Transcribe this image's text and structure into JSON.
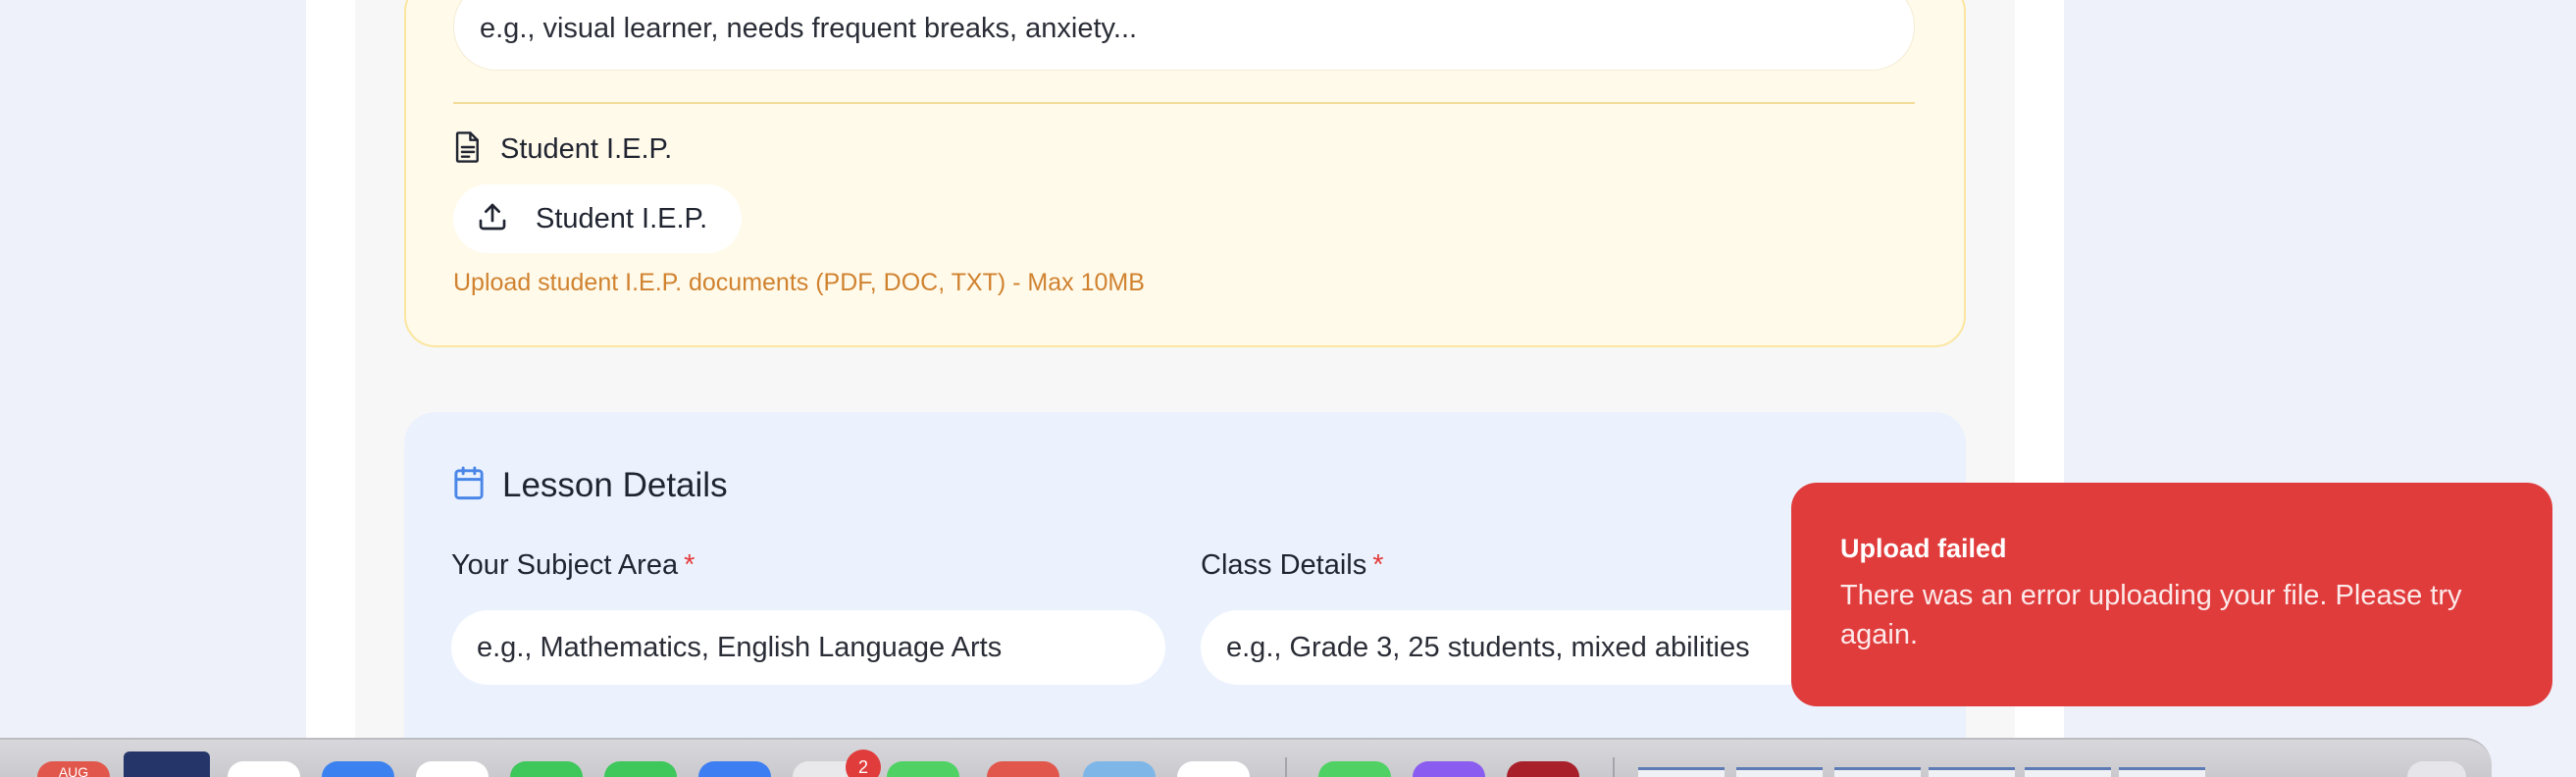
{
  "accommodations": {
    "input_value": "e.g., visual learner, needs frequent breaks, anxiety..."
  },
  "iep": {
    "heading": "Student I.E.P.",
    "upload_button_label": "Student I.E.P.",
    "upload_hint": "Upload student I.E.P. documents (PDF, DOC, TXT) - Max 10MB"
  },
  "lesson_details": {
    "title": "Lesson Details",
    "subject_label": "Your Subject Area",
    "subject_placeholder": "e.g., Mathematics, English Language Arts",
    "class_label": "Class Details",
    "class_placeholder": "e.g., Grade 3, 25 students, mixed abilities",
    "required_marker": "*"
  },
  "toast": {
    "title": "Upload failed",
    "message": "There was an error uploading your file. Please try again."
  },
  "dock": {
    "calendar_month": "AUG",
    "badge_count": "2"
  },
  "colors": {
    "toast_bg": "#e03c3c",
    "accent_blue": "#4a86e8",
    "hint_orange": "#d0822f",
    "required_red": "#e53b3b"
  }
}
